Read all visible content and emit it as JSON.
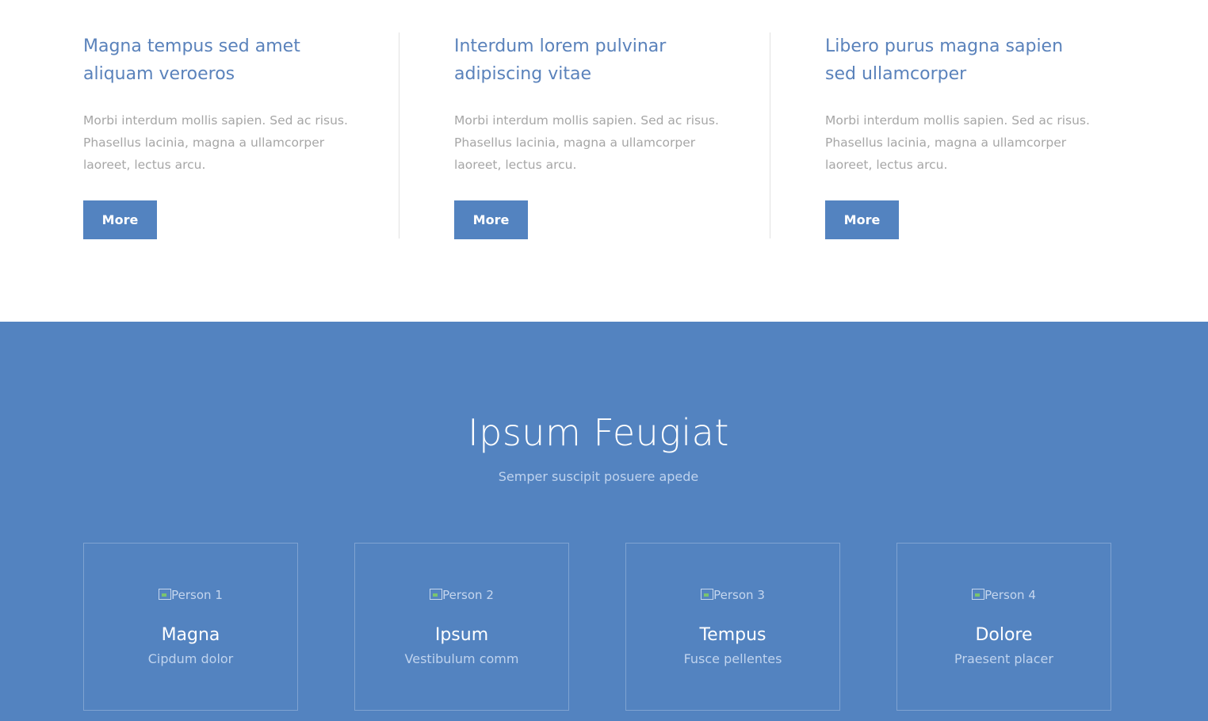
{
  "features": [
    {
      "title_line1": "Magna tempus sed amet",
      "title_line2": "aliquam veroeros",
      "text_line1": "Morbi interdum mollis sapien. Sed ac risus.",
      "text_line2": "Phasellus lacinia, magna a ullamcorper",
      "text_line3": "laoreet, lectus arcu.",
      "button_label": "More"
    },
    {
      "title_line1": "Interdum lorem pulvinar",
      "title_line2": "adipiscing vitae",
      "text_line1": "Morbi interdum mollis sapien. Sed ac risus.",
      "text_line2": "Phasellus lacinia, magna a ullamcorper",
      "text_line3": "laoreet, lectus arcu.",
      "button_label": "More"
    },
    {
      "title_line1": "Libero purus magna sapien",
      "title_line2": "sed ullamcorper",
      "text_line1": "Morbi interdum mollis sapien. Sed ac risus.",
      "text_line2": "Phasellus lacinia, magna a ullamcorper",
      "text_line3": "laoreet, lectus arcu.",
      "button_label": "More"
    }
  ],
  "team": {
    "title": "Ipsum Feugiat",
    "subtitle": "Semper suscipit posuere apede",
    "members": [
      {
        "image_alt": "Person 1",
        "name": "Magna",
        "role": "Cipdum dolor"
      },
      {
        "image_alt": "Person 2",
        "name": "Ipsum",
        "role": "Vestibulum comm"
      },
      {
        "image_alt": "Person 3",
        "name": "Tempus",
        "role": "Fusce pellentes"
      },
      {
        "image_alt": "Person 4",
        "name": "Dolore",
        "role": "Praesent placer"
      }
    ]
  },
  "colors": {
    "accent": "#5383c0",
    "heading": "#5a82bb",
    "body_text": "#a6a6a6",
    "divider": "#e2e2e2"
  }
}
